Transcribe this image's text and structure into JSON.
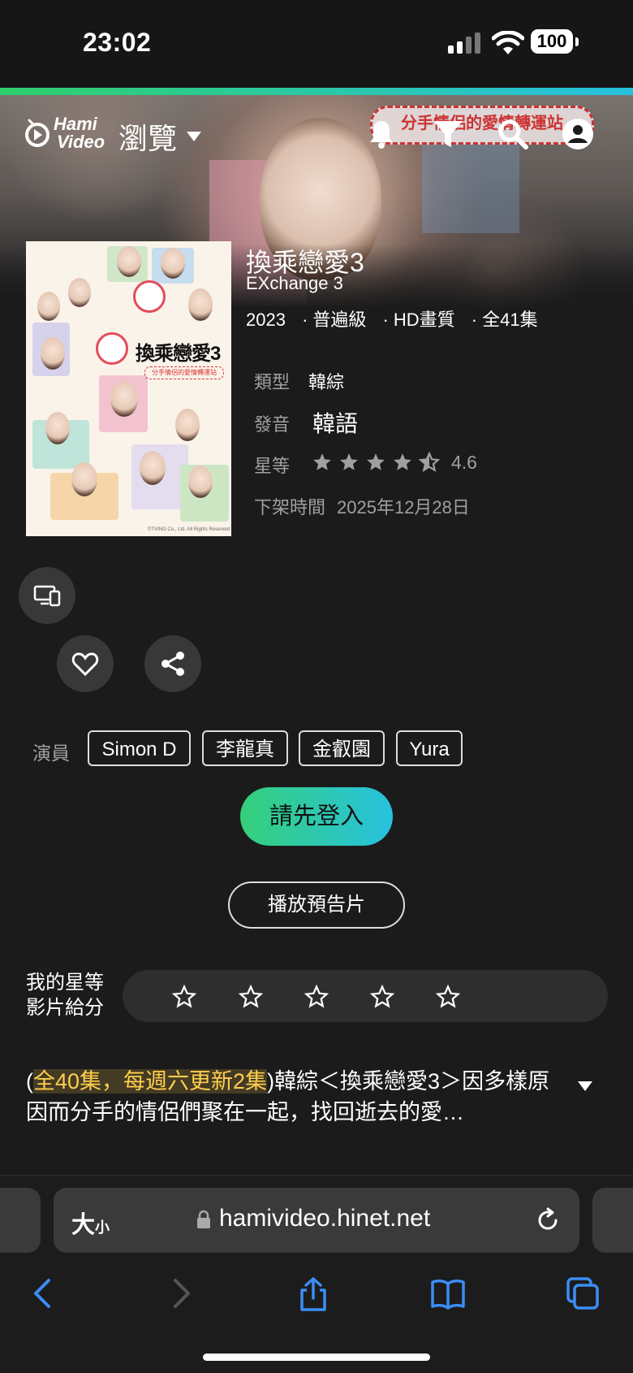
{
  "status_bar": {
    "time": "23:02",
    "battery": "100"
  },
  "header": {
    "logo_line1": "Hami",
    "logo_line2": "Video",
    "browse_label": "瀏覽"
  },
  "hero": {
    "sign_text": "分手情侶的愛情轉運站"
  },
  "poster": {
    "title": "換乘戀愛3",
    "subtitle": "分手情侶的愛情轉運站",
    "copyright": "©TVING Co., Ltd. All Rights Reserved"
  },
  "show": {
    "title": "換乘戀愛3",
    "subtitle": "EXchange 3",
    "year": "2023",
    "rating_class": "普遍級",
    "quality": "HD畫質",
    "episodes": "全41集",
    "genre_label": "類型",
    "genre": "韓綜",
    "audio_label": "發音",
    "audio": "韓語",
    "stars_label": "星等",
    "stars_value": "4.6",
    "expire_label": "下架時間",
    "expire_date": "2025年12月28日"
  },
  "actors": {
    "label": "演員",
    "names": [
      "Simon D",
      "李龍真",
      "金叡園",
      "Yura"
    ]
  },
  "buttons": {
    "login": "請先登入",
    "trailer": "播放預告片"
  },
  "my_rating": {
    "line1": "我的星等",
    "line2": "影片給分"
  },
  "description": {
    "open_paren": "(",
    "highlight": "全40集，每週六更新2集",
    "close_paren": ")",
    "text": "韓綜＜換乘戀愛3＞因多樣原因而分手的情侶們聚在一起，找回逝去的愛…"
  },
  "browser": {
    "aa_big": "大",
    "aa_small": "小",
    "url": "hamivideo.hinet.net"
  },
  "colors": {
    "accent_green": "#35d07a",
    "accent_cyan": "#27c1e0",
    "highlight": "#ffcf4d",
    "link_blue": "#3b8df5"
  }
}
